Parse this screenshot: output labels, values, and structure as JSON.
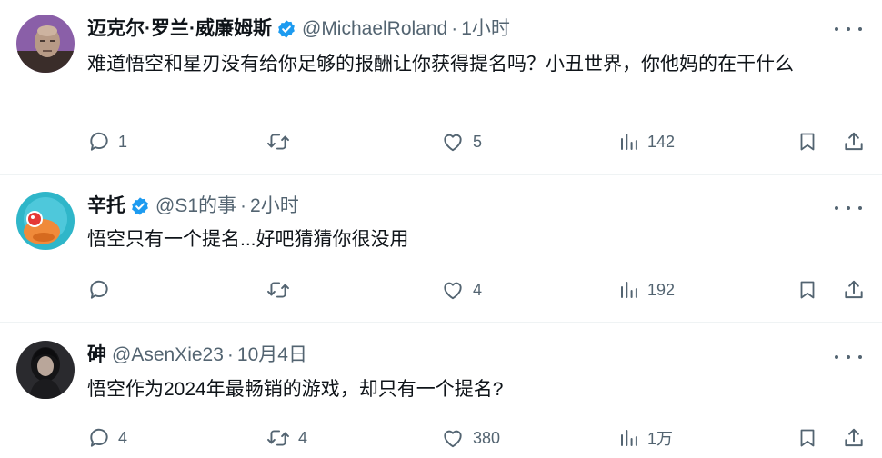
{
  "tweets": [
    {
      "name": "迈克尔·罗兰·威廉姆斯",
      "handle": "@MichaelRoland",
      "time": "1小时",
      "verified": true,
      "text": "难道悟空和星刃没有给你足够的报酬让你获得提名吗？小丑世界，你他妈的在干什么",
      "replies": "1",
      "retweets": "",
      "likes": "5",
      "views": "142",
      "avatar_icon": "bald-man-avatar"
    },
    {
      "name": "辛托",
      "handle": "@S1的事",
      "time": "2小时",
      "verified": true,
      "text": "悟空只有一个提名...好吧猜猜你很没用",
      "replies": "",
      "retweets": "",
      "likes": "4",
      "views": "192",
      "avatar_icon": "cartoon-avatar"
    },
    {
      "name": "砷",
      "handle": "@AsenXie23",
      "time": "10月4日",
      "verified": false,
      "text": "悟空作为2024年最畅销的游戏，却只有一个提名?",
      "replies": "4",
      "retweets": "4",
      "likes": "380",
      "views": "1万",
      "avatar_icon": "dark-portrait-avatar"
    }
  ],
  "separator": "·",
  "colors": {
    "text": "#0f1419",
    "secondary": "#536471",
    "verified": "#1d9bf0",
    "divider": "#eff3f4"
  }
}
